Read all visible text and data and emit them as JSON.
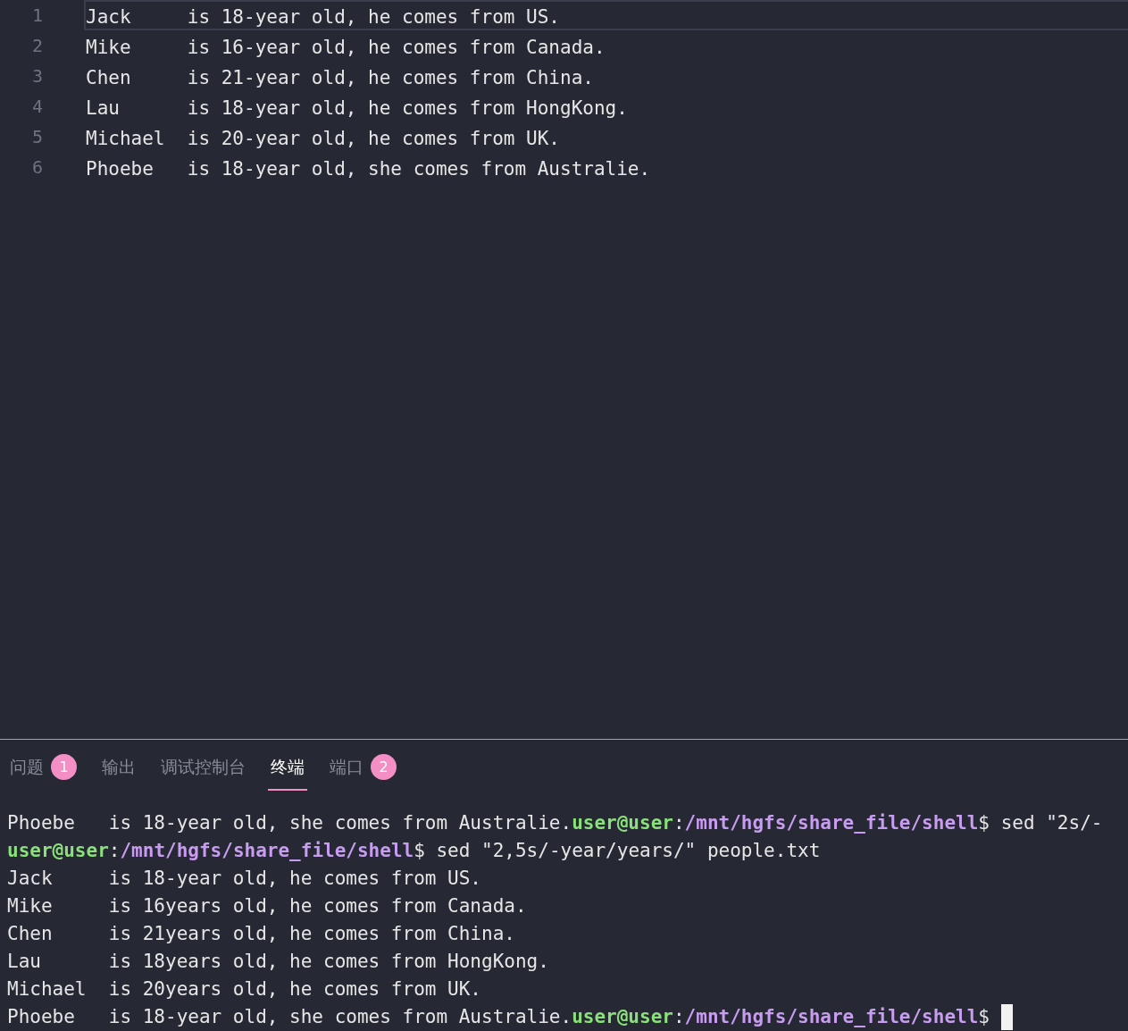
{
  "editor": {
    "lines": [
      {
        "number": "1",
        "text": "Jack     is 18-year old, he comes from US.",
        "current": true
      },
      {
        "number": "2",
        "text": "Mike     is 16-year old, he comes from Canada.",
        "current": false
      },
      {
        "number": "3",
        "text": "Chen     is 21-year old, he comes from China.",
        "current": false
      },
      {
        "number": "4",
        "text": "Lau      is 18-year old, he comes from HongKong.",
        "current": false
      },
      {
        "number": "5",
        "text": "Michael  is 20-year old, he comes from UK.",
        "current": false
      },
      {
        "number": "6",
        "text": "Phoebe   is 18-year old, she comes from Australie.",
        "current": false
      }
    ]
  },
  "panel": {
    "tabs": [
      {
        "label": "问题",
        "badge": "1",
        "selected": false
      },
      {
        "label": "输出",
        "selected": false
      },
      {
        "label": "调试控制台",
        "selected": false
      },
      {
        "label": "终端",
        "selected": true
      },
      {
        "label": "端口",
        "badge": "2",
        "selected": false
      }
    ]
  },
  "terminal": {
    "cursor": true,
    "lines": [
      [
        {
          "kind": "text",
          "text": "Phoebe   is 18-year old, she comes from Australie."
        },
        {
          "kind": "user",
          "text": "user@user"
        },
        {
          "kind": "text",
          "text": ":"
        },
        {
          "kind": "path",
          "text": "/mnt/hgfs/share_file/shell"
        },
        {
          "kind": "text",
          "text": "$ sed \"2s/-"
        }
      ],
      [
        {
          "kind": "user",
          "text": "user@user"
        },
        {
          "kind": "text",
          "text": ":"
        },
        {
          "kind": "path",
          "text": "/mnt/hgfs/share_file/shell"
        },
        {
          "kind": "text",
          "text": "$ sed \"2,5s/-year/years/\" people.txt"
        }
      ],
      [
        {
          "kind": "text",
          "text": "Jack     is 18-year old, he comes from US."
        }
      ],
      [
        {
          "kind": "text",
          "text": "Mike     is 16years old, he comes from Canada."
        }
      ],
      [
        {
          "kind": "text",
          "text": "Chen     is 21years old, he comes from China."
        }
      ],
      [
        {
          "kind": "text",
          "text": "Lau      is 18years old, he comes from HongKong."
        }
      ],
      [
        {
          "kind": "text",
          "text": "Michael  is 20years old, he comes from UK."
        }
      ],
      [
        {
          "kind": "text",
          "text": "Phoebe   is 18-year old, she comes from Australie."
        },
        {
          "kind": "user",
          "text": "user@user"
        },
        {
          "kind": "text",
          "text": ":"
        },
        {
          "kind": "path",
          "text": "/mnt/hgfs/share_file/shell"
        },
        {
          "kind": "text",
          "text": "$ "
        }
      ]
    ]
  }
}
